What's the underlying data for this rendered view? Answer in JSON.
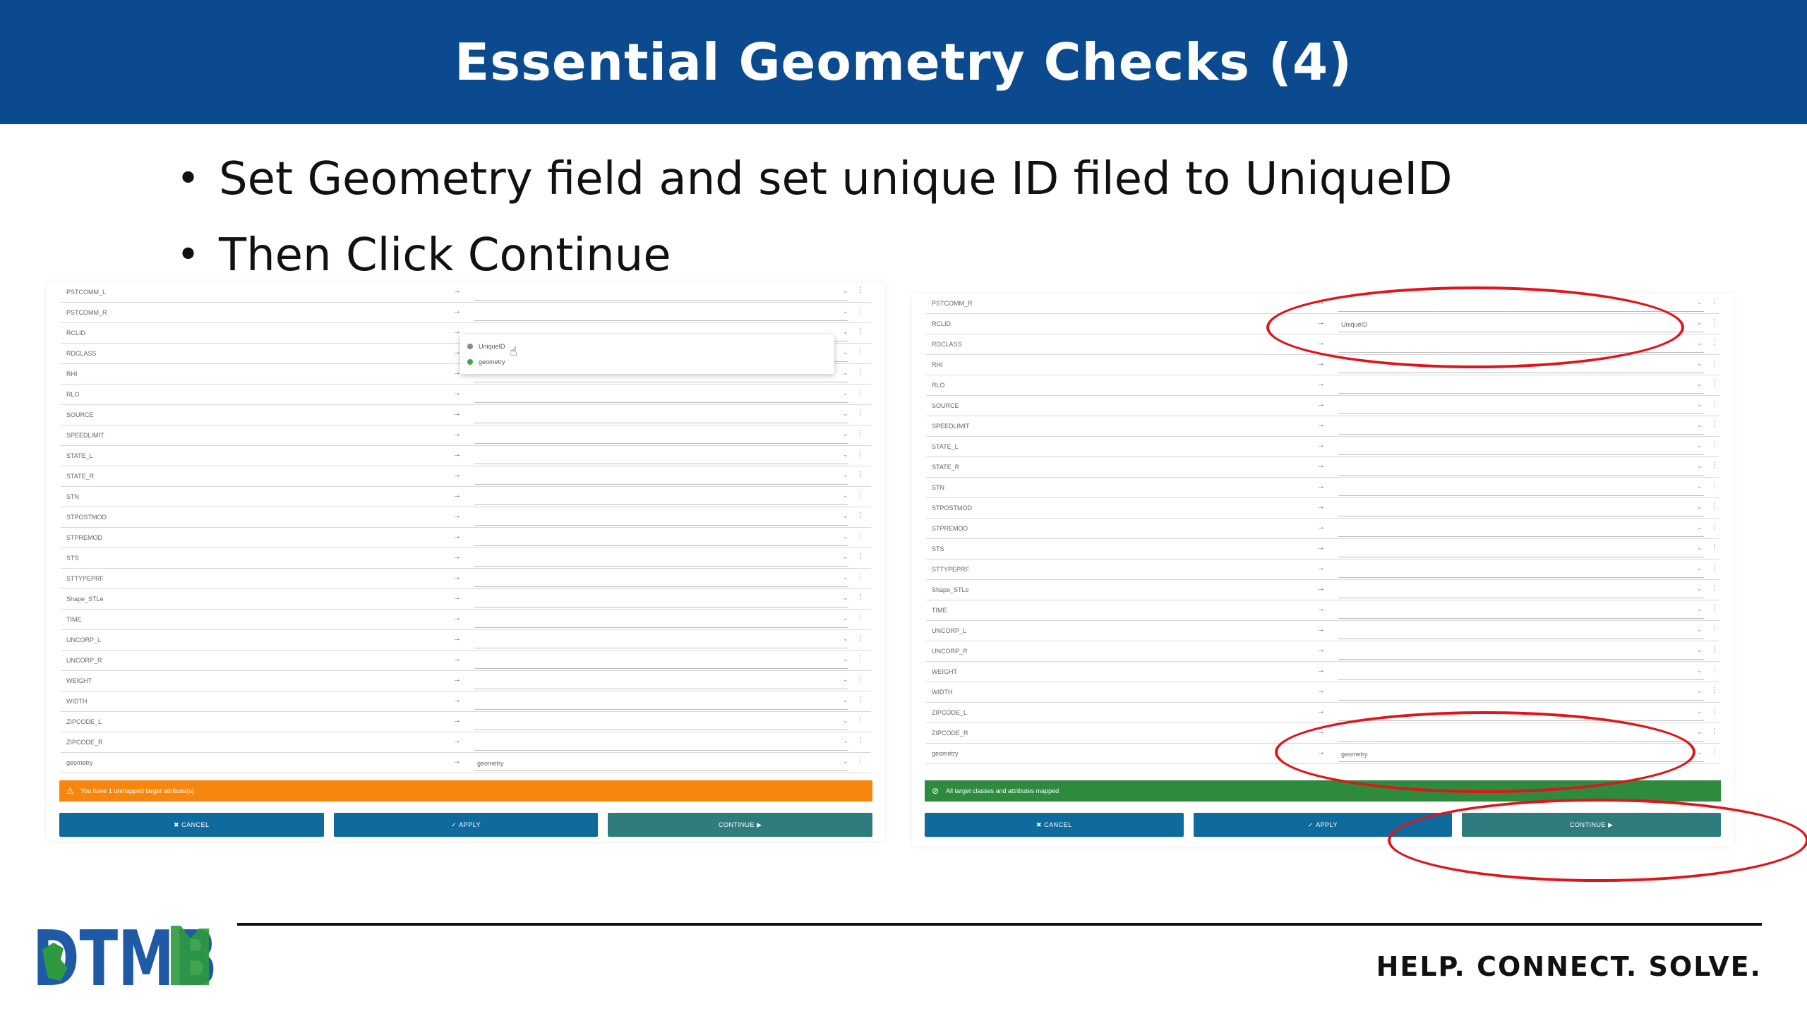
{
  "slide": {
    "title": "Essential Geometry Checks (4)",
    "bullets": [
      "Set Geometry field and set unique ID filed to UniqueID",
      "Then Click Continue"
    ],
    "tagline": "HELP. CONNECT. SOLVE.",
    "logo_text": "DTMB",
    "colors": {
      "title_bar": "#0b4a8f",
      "warning_banner": "#f7860f",
      "success_banner": "#2e8b3e",
      "button": "#0f6b9e",
      "continue_button": "#2e7d7c",
      "highlight_ring": "#e0141a",
      "logo_blue": "#1f5aa6",
      "logo_green": "#2e9a3e"
    }
  },
  "left_screenshot": {
    "rows": [
      {
        "field": "PSTCOMM_L",
        "target": ""
      },
      {
        "field": "PSTCOMM_R",
        "target": ""
      },
      {
        "field": "RCLID",
        "target": ""
      },
      {
        "field": "RDCLASS",
        "target": ""
      },
      {
        "field": "RHI",
        "target": ""
      },
      {
        "field": "RLO",
        "target": ""
      },
      {
        "field": "SOURCE",
        "target": ""
      },
      {
        "field": "SPEEDLIMIT",
        "target": ""
      },
      {
        "field": "STATE_L",
        "target": ""
      },
      {
        "field": "STATE_R",
        "target": ""
      },
      {
        "field": "STN",
        "target": ""
      },
      {
        "field": "STPOSTMOD",
        "target": ""
      },
      {
        "field": "STPREMOD",
        "target": ""
      },
      {
        "field": "STS",
        "target": ""
      },
      {
        "field": "STTYPEPRF",
        "target": ""
      },
      {
        "field": "Shape_STLe",
        "target": ""
      },
      {
        "field": "TIME",
        "target": ""
      },
      {
        "field": "UNCORP_L",
        "target": ""
      },
      {
        "field": "UNCORP_R",
        "target": ""
      },
      {
        "field": "WEIGHT",
        "target": ""
      },
      {
        "field": "WIDTH",
        "target": ""
      },
      {
        "field": "ZIPCODE_L",
        "target": ""
      },
      {
        "field": "ZIPCODE_R",
        "target": ""
      },
      {
        "field": "geometry",
        "target": "geometry"
      }
    ],
    "dropdown_options": [
      "UniqueID",
      "geometry"
    ],
    "banner_text": "You have 1 unmapped target attribute(s)",
    "buttons": {
      "cancel": "CANCEL",
      "apply": "APPLY",
      "continue": "CONTINUE"
    }
  },
  "right_screenshot": {
    "rows": [
      {
        "field": "PSTCOMM_R",
        "target": ""
      },
      {
        "field": "RCLID",
        "target": "UniqueID"
      },
      {
        "field": "RDCLASS",
        "target": ""
      },
      {
        "field": "RHI",
        "target": ""
      },
      {
        "field": "RLO",
        "target": ""
      },
      {
        "field": "SOURCE",
        "target": ""
      },
      {
        "field": "SPEEDLIMIT",
        "target": ""
      },
      {
        "field": "STATE_L",
        "target": ""
      },
      {
        "field": "STATE_R",
        "target": ""
      },
      {
        "field": "STN",
        "target": ""
      },
      {
        "field": "STPOSTMOD",
        "target": ""
      },
      {
        "field": "STPREMOD",
        "target": ""
      },
      {
        "field": "STS",
        "target": ""
      },
      {
        "field": "STTYPEPRF",
        "target": ""
      },
      {
        "field": "Shape_STLe",
        "target": ""
      },
      {
        "field": "TIME",
        "target": ""
      },
      {
        "field": "UNCORP_L",
        "target": ""
      },
      {
        "field": "UNCORP_R",
        "target": ""
      },
      {
        "field": "WEIGHT",
        "target": ""
      },
      {
        "field": "WIDTH",
        "target": ""
      },
      {
        "field": "ZIPCODE_L",
        "target": ""
      },
      {
        "field": "ZIPCODE_R",
        "target": ""
      },
      {
        "field": "geometry",
        "target": "geometry"
      }
    ],
    "banner_text": "All target classes and attributes mapped",
    "buttons": {
      "cancel": "CANCEL",
      "apply": "APPLY",
      "continue": "CONTINUE"
    }
  }
}
